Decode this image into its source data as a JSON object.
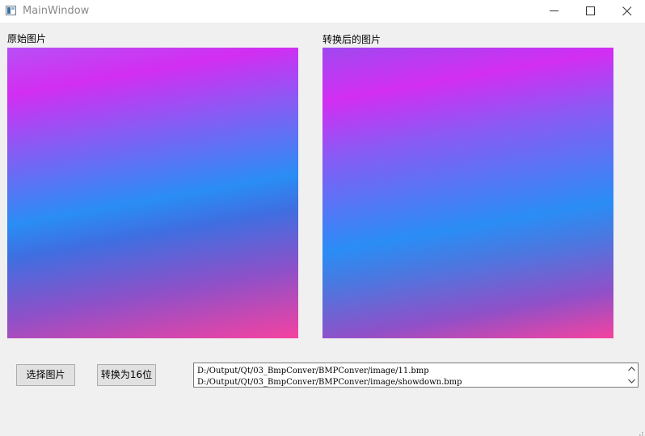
{
  "window": {
    "title": "MainWindow"
  },
  "labels": {
    "original": "原始图片",
    "converted": "转换后的图片"
  },
  "buttons": {
    "select_image": "选择图片",
    "convert_16bit": "转换为16位"
  },
  "log": {
    "lines": [
      "D:/Output/Qt/03_BmpConver/BMPConver/image/11.bmp",
      "D:/Output/Qt/03_BmpConver/BMPConver/image/showdown.bmp"
    ]
  },
  "icons": {
    "app": "app-window-icon",
    "minimize": "minimize-icon",
    "maximize": "maximize-icon",
    "close": "close-icon",
    "scroll_up": "chevron-up-icon",
    "scroll_down": "chevron-down-icon",
    "size_grip": "size-grip-icon"
  },
  "colors": {
    "titlebar": "#ffffff",
    "window_bg": "#f0f0f0",
    "button_bg": "#e1e1e1",
    "button_border": "#adadad"
  }
}
